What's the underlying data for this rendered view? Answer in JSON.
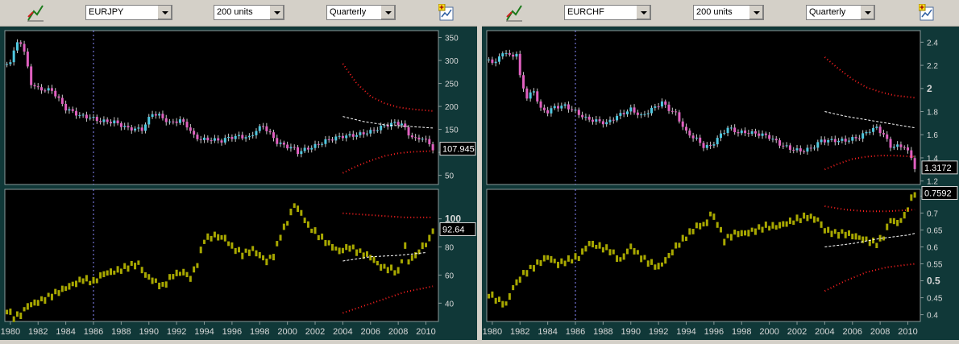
{
  "colors": {
    "background": "#000000",
    "frame": "#103838",
    "up": "#4fc8e0",
    "down": "#e060c0",
    "wick": "#c8c8c8",
    "bar": "#a8a800",
    "band": "#ff2020",
    "trend": "#ffffff",
    "axis_text": "#d8d8d8"
  },
  "x_axis": {
    "ticks": [
      "1980",
      "1982",
      "1984",
      "1986",
      "1988",
      "1990",
      "1992",
      "1994",
      "1996",
      "1998",
      "2000",
      "2002",
      "2004",
      "2006",
      "2008",
      "2010"
    ]
  },
  "panels": [
    {
      "symbol": "EURJPY",
      "units": "200 units",
      "period": "Quarterly",
      "icons": [
        "chart-tool-icon",
        "add-chart-icon"
      ],
      "price_axis": {
        "ticks": [
          "350",
          "300",
          "250",
          "200",
          "150",
          "100",
          "50"
        ],
        "ylim": [
          30,
          365
        ],
        "last_label": "107.945"
      },
      "osc_axis": {
        "ticks": [
          "100",
          "80",
          "60",
          "40"
        ],
        "bold_tick": "100",
        "ylim": [
          27,
          121
        ],
        "last_label": "92.64"
      },
      "price_anchors": [
        [
          1979.75,
          292
        ],
        [
          1980.0,
          300
        ],
        [
          1980.5,
          338
        ],
        [
          1980.75,
          340
        ],
        [
          1981.0,
          318
        ],
        [
          1981.5,
          250
        ],
        [
          1982.0,
          238
        ],
        [
          1983.0,
          235
        ],
        [
          1983.5,
          215
        ],
        [
          1984.0,
          195
        ],
        [
          1984.5,
          188
        ],
        [
          1985.0,
          180
        ],
        [
          1985.75,
          176
        ],
        [
          1986.5,
          168
        ],
        [
          1987.5,
          166
        ],
        [
          1988.5,
          152
        ],
        [
          1989.5,
          150
        ],
        [
          1990.25,
          185
        ],
        [
          1990.75,
          180
        ],
        [
          1991.5,
          164
        ],
        [
          1992.25,
          170
        ],
        [
          1992.75,
          158
        ],
        [
          1993.25,
          135
        ],
        [
          1993.75,
          128
        ],
        [
          1994.5,
          128
        ],
        [
          1995.25,
          125
        ],
        [
          1995.75,
          132
        ],
        [
          1996.5,
          135
        ],
        [
          1997.25,
          132
        ],
        [
          1997.75,
          148
        ],
        [
          1998.25,
          158
        ],
        [
          1998.75,
          140
        ],
        [
          1999.25,
          122
        ],
        [
          1999.75,
          115
        ],
        [
          2000.5,
          108
        ],
        [
          2000.75,
          100
        ],
        [
          2001.25,
          106
        ],
        [
          2002.0,
          114
        ],
        [
          2002.75,
          125
        ],
        [
          2003.5,
          132
        ],
        [
          2004.0,
          135
        ],
        [
          2005.0,
          138
        ],
        [
          2006.0,
          145
        ],
        [
          2007.0,
          158
        ],
        [
          2007.75,
          164
        ],
        [
          2008.25,
          162
        ],
        [
          2008.75,
          140
        ],
        [
          2009.25,
          128
        ],
        [
          2009.75,
          132
        ],
        [
          2010.25,
          118
        ],
        [
          2010.5,
          107.945
        ]
      ],
      "osc_anchors": [
        [
          1979.75,
          35
        ],
        [
          1980.25,
          30
        ],
        [
          1980.75,
          32
        ],
        [
          1981.25,
          38
        ],
        [
          1982.25,
          42
        ],
        [
          1983.25,
          47
        ],
        [
          1984.25,
          52
        ],
        [
          1985.25,
          57
        ],
        [
          1986.0,
          55
        ],
        [
          1986.75,
          61
        ],
        [
          1987.75,
          63
        ],
        [
          1988.75,
          67
        ],
        [
          1989.25,
          68
        ],
        [
          1989.75,
          60
        ],
        [
          1990.5,
          55
        ],
        [
          1991.0,
          52
        ],
        [
          1991.75,
          60
        ],
        [
          1992.5,
          62
        ],
        [
          1993.0,
          58
        ],
        [
          1993.5,
          68
        ],
        [
          1994.0,
          85
        ],
        [
          1994.75,
          88
        ],
        [
          1995.5,
          86
        ],
        [
          1996.0,
          80
        ],
        [
          1996.75,
          75
        ],
        [
          1997.5,
          78
        ],
        [
          1998.0,
          74
        ],
        [
          1998.5,
          70
        ],
        [
          1999.0,
          74
        ],
        [
          1999.5,
          88
        ],
        [
          2000.0,
          98
        ],
        [
          2000.5,
          110
        ],
        [
          2001.0,
          104
        ],
        [
          2001.5,
          95
        ],
        [
          2002.25,
          88
        ],
        [
          2003.0,
          82
        ],
        [
          2003.75,
          77
        ],
        [
          2004.5,
          80
        ],
        [
          2005.25,
          76
        ],
        [
          2006.0,
          73
        ],
        [
          2006.75,
          66
        ],
        [
          2007.5,
          64
        ],
        [
          2008.0,
          62
        ],
        [
          2008.5,
          80
        ],
        [
          2008.75,
          70
        ],
        [
          2009.25,
          74
        ],
        [
          2009.75,
          80
        ],
        [
          2010.25,
          85
        ],
        [
          2010.5,
          92.64
        ]
      ],
      "upper_band": [
        [
          2004.0,
          293
        ],
        [
          2005.0,
          250
        ],
        [
          2006.0,
          222
        ],
        [
          2007.0,
          207
        ],
        [
          2008.0,
          198
        ],
        [
          2009.0,
          194
        ],
        [
          2010.5,
          190
        ]
      ],
      "lower_band": [
        [
          2004.0,
          55
        ],
        [
          2005.0,
          70
        ],
        [
          2006.0,
          82
        ],
        [
          2007.0,
          92
        ],
        [
          2008.0,
          98
        ],
        [
          2009.0,
          101
        ],
        [
          2010.5,
          103
        ]
      ],
      "trend": [
        [
          2004.0,
          178
        ],
        [
          2005.5,
          167
        ],
        [
          2007.0,
          160
        ],
        [
          2008.5,
          157
        ],
        [
          2010.5,
          153
        ]
      ],
      "osc_upper_band": [
        [
          2004.0,
          104
        ],
        [
          2005.5,
          103
        ],
        [
          2007.0,
          102
        ],
        [
          2008.5,
          101
        ],
        [
          2010.5,
          101
        ]
      ],
      "osc_lower_band": [
        [
          2004.0,
          33
        ],
        [
          2005.5,
          38
        ],
        [
          2007.0,
          43
        ],
        [
          2008.5,
          48
        ],
        [
          2010.5,
          52
        ]
      ],
      "osc_trend": [
        [
          2004.0,
          70
        ],
        [
          2006.0,
          73
        ],
        [
          2008.0,
          74
        ],
        [
          2010.0,
          76
        ]
      ]
    },
    {
      "symbol": "EURCHF",
      "units": "200 units",
      "period": "Quarterly",
      "icons": [
        "chart-tool-icon",
        "add-chart-icon"
      ],
      "price_axis": {
        "ticks": [
          "2.4",
          "2.2",
          "2",
          "1.8",
          "1.6",
          "1.4",
          "1.2"
        ],
        "bold_tick": "2",
        "ylim": [
          1.17,
          2.5
        ],
        "last_label": "1.3172"
      },
      "osc_axis": {
        "ticks": [
          "0.75",
          "0.7",
          "0.65",
          "0.6",
          "0.55",
          "0.5",
          "0.45",
          "0.4"
        ],
        "bold_tick": "0.5",
        "ylim": [
          0.38,
          0.77
        ],
        "last_label": "0.7592"
      },
      "price_anchors": [
        [
          1979.75,
          2.25
        ],
        [
          1980.25,
          2.22
        ],
        [
          1980.75,
          2.32
        ],
        [
          1981.25,
          2.28
        ],
        [
          1981.75,
          2.3
        ],
        [
          1982.0,
          2.1
        ],
        [
          1982.5,
          1.92
        ],
        [
          1983.0,
          1.98
        ],
        [
          1983.5,
          1.82
        ],
        [
          1984.0,
          1.8
        ],
        [
          1984.5,
          1.84
        ],
        [
          1985.25,
          1.85
        ],
        [
          1986.0,
          1.8
        ],
        [
          1986.75,
          1.74
        ],
        [
          1987.5,
          1.72
        ],
        [
          1988.25,
          1.7
        ],
        [
          1989.0,
          1.76
        ],
        [
          1990.0,
          1.82
        ],
        [
          1990.75,
          1.76
        ],
        [
          1991.5,
          1.82
        ],
        [
          1992.25,
          1.88
        ],
        [
          1992.75,
          1.82
        ],
        [
          1993.25,
          1.78
        ],
        [
          1994.0,
          1.62
        ],
        [
          1994.75,
          1.56
        ],
        [
          1995.25,
          1.5
        ],
        [
          1995.75,
          1.5
        ],
        [
          1996.5,
          1.6
        ],
        [
          1997.0,
          1.66
        ],
        [
          1997.75,
          1.62
        ],
        [
          1998.5,
          1.62
        ],
        [
          1999.5,
          1.6
        ],
        [
          2000.0,
          1.58
        ],
        [
          2000.75,
          1.52
        ],
        [
          2001.5,
          1.48
        ],
        [
          2002.25,
          1.46
        ],
        [
          2003.0,
          1.48
        ],
        [
          2003.75,
          1.55
        ],
        [
          2004.5,
          1.55
        ],
        [
          2005.5,
          1.55
        ],
        [
          2006.5,
          1.58
        ],
        [
          2007.25,
          1.64
        ],
        [
          2007.75,
          1.66
        ],
        [
          2008.25,
          1.6
        ],
        [
          2008.75,
          1.5
        ],
        [
          2009.25,
          1.5
        ],
        [
          2009.75,
          1.5
        ],
        [
          2010.25,
          1.4
        ],
        [
          2010.5,
          1.3172
        ]
      ],
      "osc_anchors": [
        [
          1979.75,
          0.46
        ],
        [
          1980.5,
          0.44
        ],
        [
          1981.0,
          0.43
        ],
        [
          1981.5,
          0.48
        ],
        [
          1982.25,
          0.52
        ],
        [
          1983.25,
          0.55
        ],
        [
          1984.0,
          0.57
        ],
        [
          1984.75,
          0.55
        ],
        [
          1985.5,
          0.56
        ],
        [
          1986.25,
          0.57
        ],
        [
          1987.0,
          0.61
        ],
        [
          1987.75,
          0.6
        ],
        [
          1988.5,
          0.59
        ],
        [
          1989.25,
          0.56
        ],
        [
          1990.0,
          0.6
        ],
        [
          1990.75,
          0.57
        ],
        [
          1991.5,
          0.55
        ],
        [
          1992.0,
          0.54
        ],
        [
          1992.5,
          0.56
        ],
        [
          1993.25,
          0.6
        ],
        [
          1994.0,
          0.63
        ],
        [
          1994.75,
          0.66
        ],
        [
          1995.5,
          0.67
        ],
        [
          1995.75,
          0.7
        ],
        [
          1996.25,
          0.67
        ],
        [
          1996.75,
          0.62
        ],
        [
          1997.5,
          0.64
        ],
        [
          1998.25,
          0.64
        ],
        [
          1999.0,
          0.65
        ],
        [
          1999.75,
          0.66
        ],
        [
          2000.5,
          0.66
        ],
        [
          2001.25,
          0.67
        ],
        [
          2002.0,
          0.68
        ],
        [
          2002.75,
          0.69
        ],
        [
          2003.5,
          0.68
        ],
        [
          2004.0,
          0.65
        ],
        [
          2004.75,
          0.64
        ],
        [
          2005.5,
          0.64
        ],
        [
          2006.25,
          0.63
        ],
        [
          2007.0,
          0.62
        ],
        [
          2007.75,
          0.61
        ],
        [
          2008.25,
          0.63
        ],
        [
          2008.75,
          0.68
        ],
        [
          2009.25,
          0.67
        ],
        [
          2009.75,
          0.69
        ],
        [
          2010.25,
          0.74
        ],
        [
          2010.5,
          0.7592
        ]
      ],
      "upper_band": [
        [
          2004.0,
          2.27
        ],
        [
          2005.0,
          2.17
        ],
        [
          2006.0,
          2.08
        ],
        [
          2007.0,
          2.01
        ],
        [
          2008.0,
          1.97
        ],
        [
          2009.0,
          1.94
        ],
        [
          2010.5,
          1.92
        ]
      ],
      "lower_band": [
        [
          2004.0,
          1.3
        ],
        [
          2005.0,
          1.35
        ],
        [
          2006.0,
          1.39
        ],
        [
          2007.0,
          1.41
        ],
        [
          2008.0,
          1.42
        ],
        [
          2009.0,
          1.42
        ],
        [
          2010.5,
          1.41
        ]
      ],
      "trend": [
        [
          2004.0,
          1.8
        ],
        [
          2005.5,
          1.76
        ],
        [
          2007.0,
          1.73
        ],
        [
          2008.5,
          1.7
        ],
        [
          2010.5,
          1.66
        ]
      ],
      "osc_upper_band": [
        [
          2004.0,
          0.72
        ],
        [
          2005.5,
          0.71
        ],
        [
          2007.0,
          0.705
        ],
        [
          2008.5,
          0.705
        ],
        [
          2010.5,
          0.71
        ]
      ],
      "osc_lower_band": [
        [
          2004.0,
          0.47
        ],
        [
          2005.5,
          0.5
        ],
        [
          2007.0,
          0.525
        ],
        [
          2008.5,
          0.54
        ],
        [
          2010.5,
          0.55
        ]
      ],
      "osc_trend": [
        [
          2004.0,
          0.6
        ],
        [
          2006.0,
          0.61
        ],
        [
          2008.0,
          0.625
        ],
        [
          2010.0,
          0.635
        ],
        [
          2010.5,
          0.64
        ]
      ]
    }
  ]
}
